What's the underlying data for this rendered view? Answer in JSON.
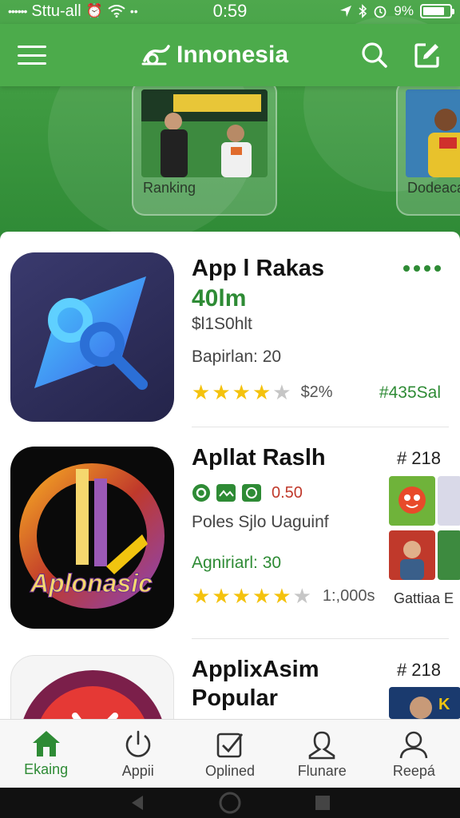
{
  "status_bar": {
    "signal_dots": "••••••",
    "carrier": "Sttu-all",
    "time": "0:59",
    "battery_text": "9%",
    "battery_level": 0.8
  },
  "header": {
    "title": "Innonesia",
    "accent_color": "#4cab4b"
  },
  "featured": [
    {
      "label": "Ranking"
    },
    {
      "label": "Dodeaca"
    }
  ],
  "apps": [
    {
      "title": "App l Rakas",
      "subtitle": "40lm",
      "price": "$l1S0hlt",
      "meta": "Bapirlan: 20",
      "rating": 4,
      "rating_text": "$2%",
      "tag": "#435Sal"
    },
    {
      "title": "Apllat Raslh",
      "rank": "# 218",
      "badge_text": "0.50",
      "desc": "Poles Sjlo Uaguinf",
      "meta": "Agniriarl: 30",
      "rating": 5,
      "rating_text": "1:,000s",
      "icon_text": "Aplonasic",
      "side_caption": "Gattiaa E"
    },
    {
      "title": "ApplixAsim",
      "title2": "Popular",
      "rank": "# 218"
    }
  ],
  "tabs": [
    {
      "label": "Ekaing",
      "icon": "home-icon"
    },
    {
      "label": "Appii",
      "icon": "power-icon"
    },
    {
      "label": "Oplined",
      "icon": "checkbox-icon"
    },
    {
      "label": "Flunare",
      "icon": "user-outline-icon"
    },
    {
      "label": "Reepá",
      "icon": "profile-icon"
    }
  ]
}
